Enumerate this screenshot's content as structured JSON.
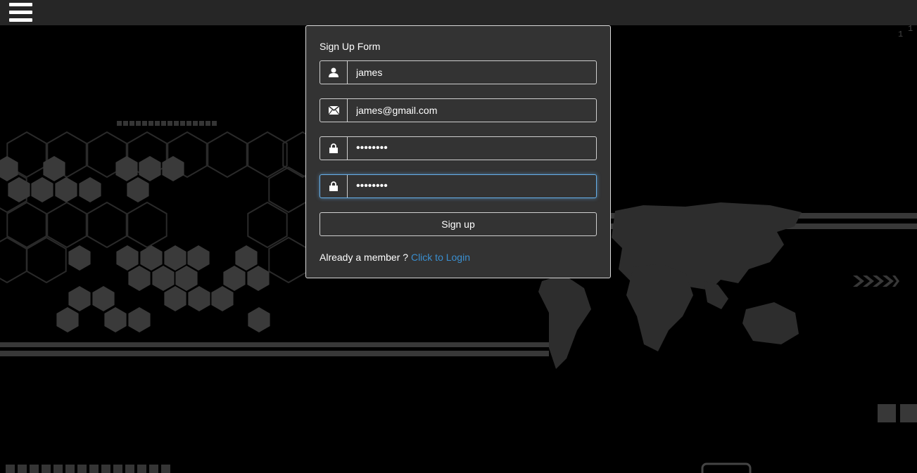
{
  "form": {
    "title": "Sign Up Form",
    "username": {
      "value": "james",
      "icon": "user-icon"
    },
    "email": {
      "value": "james@gmail.com",
      "icon": "envelope-icon"
    },
    "password": {
      "value": "12345678",
      "icon": "lock-icon"
    },
    "confirm_password": {
      "value": "12345678",
      "icon": "lock-icon"
    },
    "submit_label": "Sign up",
    "member_text": "Already a member ?",
    "login_link": "Click to Login"
  },
  "menu": {
    "icon": "hamburger-menu-icon"
  },
  "colors": {
    "page_bg": "#000000",
    "topbar_bg": "#262626",
    "card_bg": "#333333",
    "link": "#3a8fd0",
    "focus": "#66afe9"
  }
}
